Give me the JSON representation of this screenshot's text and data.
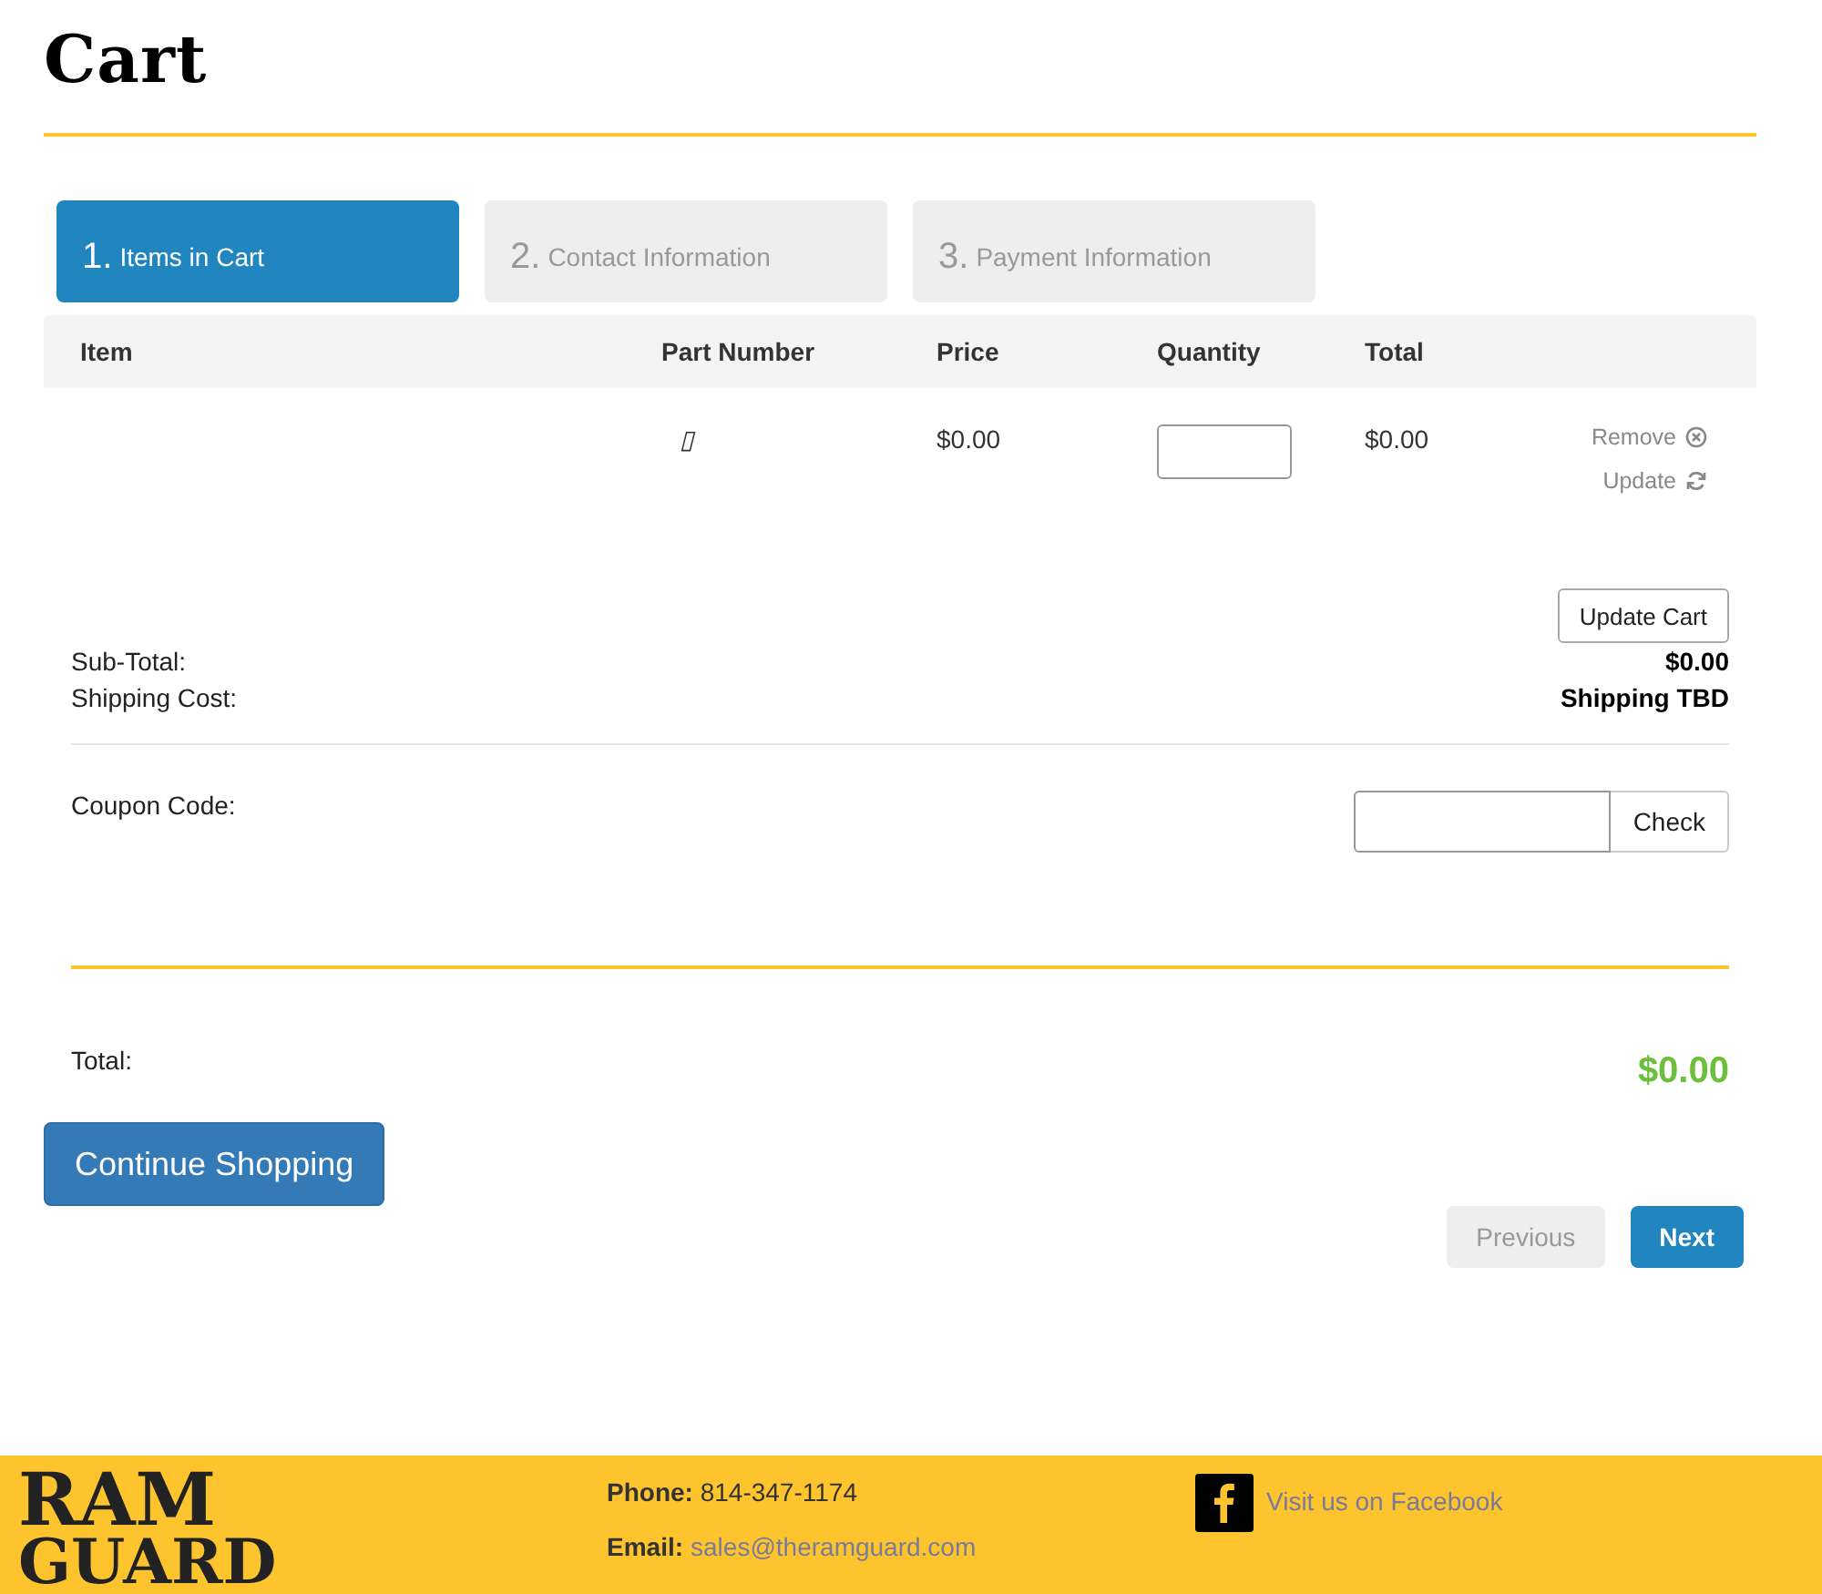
{
  "title": "Cart",
  "steps": [
    {
      "number": "1.",
      "label": "Items in Cart",
      "selected": true
    },
    {
      "number": "2.",
      "label": "Contact Information",
      "selected": false
    },
    {
      "number": "3.",
      "label": "Payment Information",
      "selected": false
    }
  ],
  "table": {
    "columns": [
      "Item",
      "Part Number",
      "Price",
      "Quantity",
      "Total"
    ],
    "rows": [
      {
        "item": "",
        "part_number": "▯",
        "price": "$0.00",
        "quantity": "",
        "total": "$0.00",
        "actions": [
          "Remove",
          "Update"
        ]
      }
    ]
  },
  "update_cart_button": "Update Cart",
  "summary": [
    {
      "label": "Sub-Total:",
      "value": "$0.00"
    },
    {
      "label": "Shipping Cost:",
      "value": "Shipping TBD"
    }
  ],
  "coupon": {
    "label": "Coupon Code:",
    "button": "Check"
  },
  "total": {
    "label": "Total:",
    "value": "$0.00"
  },
  "continue_button": "Continue Shopping",
  "nav": [
    {
      "label": "Previous",
      "disabled": true
    },
    {
      "label": "Next",
      "disabled": false
    }
  ],
  "footer": {
    "logo": [
      "RAM",
      "GUARD"
    ],
    "phone_label": "Phone:",
    "phone": "814-347-1174",
    "email_label": "Email:",
    "email": "sales@theramguard.com",
    "facebook": "Visit us on Facebook"
  }
}
